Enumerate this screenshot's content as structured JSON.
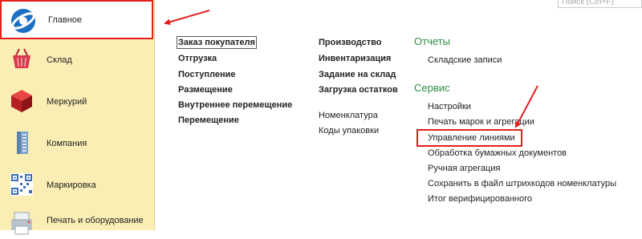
{
  "search": {
    "placeholder": "Поиск (Ctrl+F)"
  },
  "sidebar": {
    "items": [
      {
        "label": "Главное",
        "icon": "main-logo-icon"
      },
      {
        "label": "Склад",
        "icon": "basket-icon"
      },
      {
        "label": "Меркурий",
        "icon": "red-cube-icon"
      },
      {
        "label": "Компания",
        "icon": "building-icon"
      },
      {
        "label": "Маркировка",
        "icon": "qr-code-icon"
      },
      {
        "label": "Печать и оборудование",
        "icon": "printer-icon"
      }
    ]
  },
  "columns": {
    "col1": [
      "Заказ покупателя",
      "Отгрузка",
      "Поступление",
      "Размещение",
      "Внутреннее перемещение",
      "Перемещение"
    ],
    "col2_bold": [
      "Производство",
      "Инвентаризация",
      "Задание на склад",
      "Загрузка остатков"
    ],
    "col2_plain": [
      "Номенклатура",
      "Коды упаковки"
    ]
  },
  "reports": {
    "title": "Отчеты",
    "items": [
      "Складские записи"
    ]
  },
  "service": {
    "title": "Сервис",
    "items": [
      "Настройки",
      "Печать марок и агрегации",
      "Управление линиями",
      "Обработка бумажных документов",
      "Ручная агрегация",
      "Сохранить в файл штрихкодов номенклатуры",
      "Итог верифицированного"
    ]
  },
  "colors": {
    "sidebar_bg": "#fbeeb4",
    "accent_red": "#e21f1f",
    "section_green": "#2e8b3f"
  }
}
